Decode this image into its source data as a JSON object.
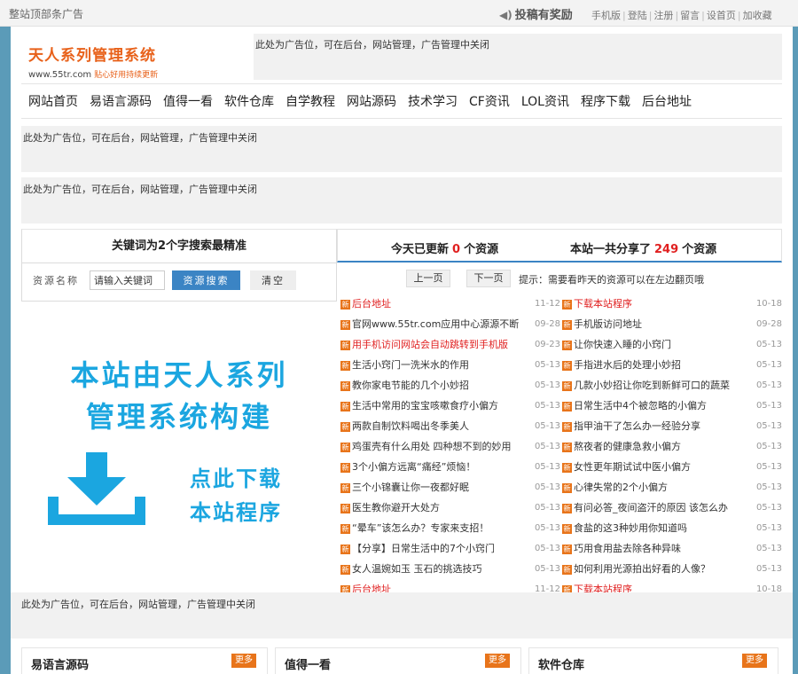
{
  "topbar": {
    "ad_text": "整站顶部条广告",
    "contribute": "投稿有奖励",
    "links": [
      "手机版",
      "登陆",
      "注册",
      "留言",
      "设首页",
      "加收藏"
    ]
  },
  "header": {
    "logo_title": "天人系列管理系统",
    "logo_url": "www.55tr.com",
    "logo_slogan": "贴心好用持续更新",
    "ad_text": "此处为广告位，可在后台，网站管理，广告管理中关闭"
  },
  "nav": [
    "网站首页",
    "易语言源码",
    "值得一看",
    "软件仓库",
    "自学教程",
    "网站源码",
    "技术学习",
    "CF资讯",
    "LOL资讯",
    "程序下载",
    "后台地址"
  ],
  "ads": {
    "bar1": "此处为广告位，可在后台，网站管理，广告管理中关闭",
    "bar2": "此处为广告位，可在后台，网站管理，广告管理中关闭",
    "bottom": "此处为广告位，可在后台，网站管理，广告管理中关闭"
  },
  "search": {
    "heading": "关键词为2个字搜索最精准",
    "label": "资源名称",
    "placeholder": "请输入关键词",
    "search_btn": "资源搜索",
    "clear_btn": "清空"
  },
  "banner": {
    "line1": "本站由天人系列",
    "line2": "管理系统构建",
    "dl1": "点此下载",
    "dl2": "本站程序"
  },
  "stats": {
    "today_prefix": "今天已更新",
    "today_count": "0",
    "today_suffix": "个资源",
    "total_prefix": "本站一共分享了",
    "total_count": "249",
    "total_suffix": "个资源"
  },
  "pager": {
    "prev": "上一页",
    "next": "下一页",
    "tip": "提示：需要看昨天的资源可以在左边翻页哦"
  },
  "resources_left": [
    {
      "title": "后台地址",
      "date": "11-12",
      "red": true
    },
    {
      "title": "官网www.55tr.com应用中心源源不断",
      "date": "09-28",
      "red": false
    },
    {
      "title": "用手机访问网站会自动跳转到手机版",
      "date": "09-23",
      "red": true
    },
    {
      "title": "生活小窍门一洗米水的作用",
      "date": "05-13",
      "red": false
    },
    {
      "title": "教你家电节能的几个小妙招",
      "date": "05-13",
      "red": false
    },
    {
      "title": "生活中常用的宝宝咳嗽食疗小偏方",
      "date": "05-13",
      "red": false
    },
    {
      "title": "两款自制饮料喝出冬季美人",
      "date": "05-13",
      "red": false
    },
    {
      "title": "鸡蛋壳有什么用处 四种想不到的妙用",
      "date": "05-13",
      "red": false
    },
    {
      "title": "3个小偏方远离“痛经”烦恼！",
      "date": "05-13",
      "red": false
    },
    {
      "title": "三个小锦囊让你一夜都好眠",
      "date": "05-13",
      "red": false
    },
    {
      "title": "医生教你避开大处方",
      "date": "05-13",
      "red": false
    },
    {
      "title": "“晕车”该怎么办？专家来支招！",
      "date": "05-13",
      "red": false
    },
    {
      "title": "【分享】日常生活中的7个小窍门",
      "date": "05-13",
      "red": false
    },
    {
      "title": "女人温婉如玉 玉石的挑选技巧",
      "date": "05-13",
      "red": false
    },
    {
      "title": "后台地址",
      "date": "11-12",
      "red": true
    }
  ],
  "resources_right": [
    {
      "title": "下载本站程序",
      "date": "10-18",
      "red": true
    },
    {
      "title": "手机版访问地址",
      "date": "09-28",
      "red": false
    },
    {
      "title": "让你快速入睡的小窍门",
      "date": "05-13",
      "red": false
    },
    {
      "title": "手指进水后的处理小妙招",
      "date": "05-13",
      "red": false
    },
    {
      "title": "几款小妙招让你吃到新鲜可口的蔬菜",
      "date": "05-13",
      "red": false
    },
    {
      "title": "日常生活中4个被忽略的小偏方",
      "date": "05-13",
      "red": false
    },
    {
      "title": "指甲油干了怎么办一经验分享",
      "date": "05-13",
      "red": false
    },
    {
      "title": "熬夜者的健康急救小偏方",
      "date": "05-13",
      "red": false
    },
    {
      "title": "女性更年期试试中医小偏方",
      "date": "05-13",
      "red": false
    },
    {
      "title": "心律失常的2个小偏方",
      "date": "05-13",
      "red": false
    },
    {
      "title": "有问必答_夜间盗汗的原因 该怎么办",
      "date": "05-13",
      "red": false
    },
    {
      "title": "食盐的这3种妙用你知道吗",
      "date": "05-13",
      "red": false
    },
    {
      "title": "巧用食用盐去除各种异味",
      "date": "05-13",
      "red": false
    },
    {
      "title": "如何利用光源拍出好看的人像？",
      "date": "05-13",
      "red": false
    },
    {
      "title": "下载本站程序",
      "date": "10-18",
      "red": true
    }
  ],
  "new_badge": "新",
  "sections": [
    {
      "title": "易语言源码",
      "more": "更多"
    },
    {
      "title": "值得一看",
      "more": "更多"
    },
    {
      "title": "软件仓库",
      "more": "更多"
    }
  ]
}
